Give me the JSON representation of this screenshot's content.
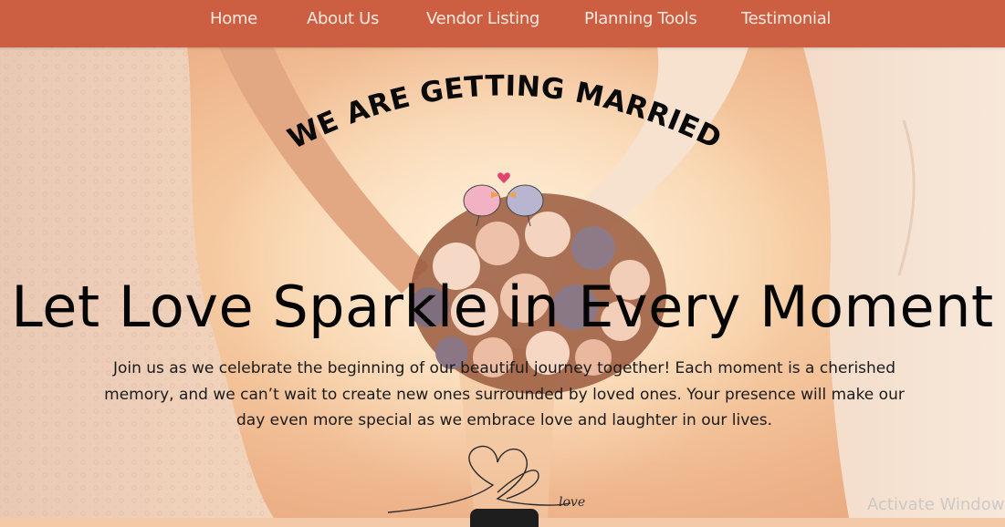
{
  "nav": {
    "items": [
      {
        "label": "Home"
      },
      {
        "label": "About Us"
      },
      {
        "label": "Vendor Listing"
      },
      {
        "label": "Planning Tools"
      },
      {
        "label": "Testimonial"
      }
    ]
  },
  "hero": {
    "arc_title": "WE ARE GETTING MARRIED",
    "heading": "Let Love Sparkle in Every Moment",
    "description": "Join us as we celebrate the beginning of our beautiful journey together! Each moment is a cherished memory, and we can’t wait to create new ones surrounded by loved ones. Your presence will make our day even more special as we embrace love and laughter in our lives.",
    "signature_word": "love"
  },
  "watermark": "Activate Window",
  "colors": {
    "nav_bg": "#cc5f41",
    "nav_text": "#fbe9e2",
    "heading": "#050505"
  }
}
